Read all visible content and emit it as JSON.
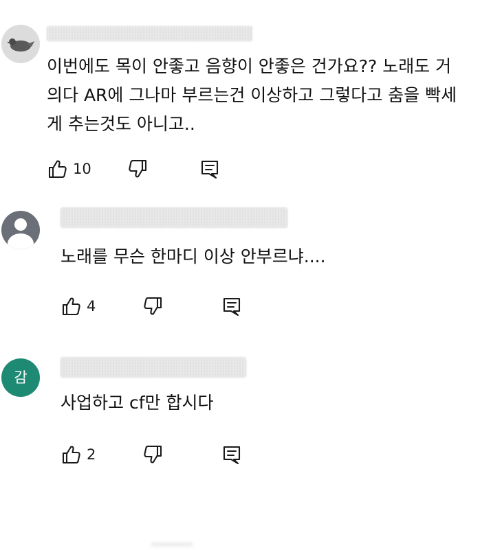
{
  "comments": [
    {
      "avatar": {
        "type": "photo",
        "icon": "bird-avatar-icon"
      },
      "meta": "",
      "text": "이번에도 목이 안좋고 음향이 안좋은 건가요?? 노래도 거\n의다 AR에 그나마 부르는건 이상하고 그렇다고 춤을 빡세\n게 추는것도 아니고..",
      "likes": "10"
    },
    {
      "avatar": {
        "type": "default",
        "icon": "default-user-avatar-icon"
      },
      "meta": "",
      "text": "노래를 무슨 한마디 이상 안부르냐....",
      "likes": "4"
    },
    {
      "avatar": {
        "type": "letter",
        "letter": "감",
        "color": "#1e8a74"
      },
      "meta": "",
      "text": "사업하고 cf만 합시다",
      "likes": "2"
    }
  ],
  "icons": {
    "like": "thumbs-up-icon",
    "dislike": "thumbs-down-icon",
    "reply": "reply-icon"
  }
}
